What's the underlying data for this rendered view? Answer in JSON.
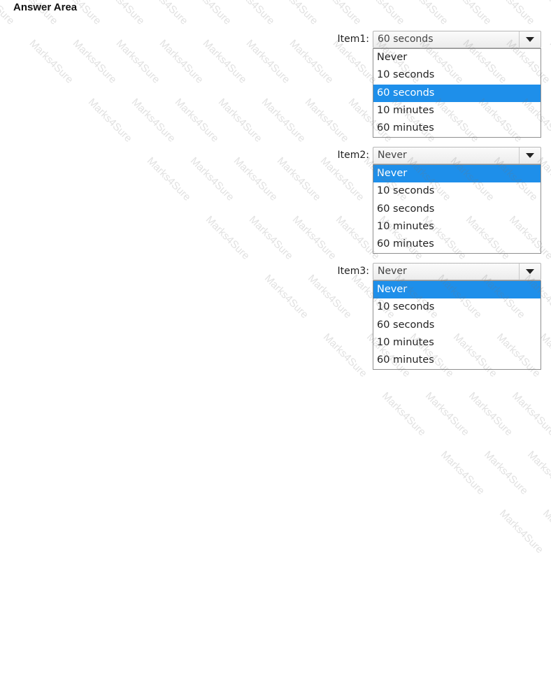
{
  "title": "Answer Area",
  "watermark": "Marks4Sure",
  "colors": {
    "highlight": "#1e8fea",
    "highlight_text": "#ffffff"
  },
  "items": [
    {
      "label": "Item1:",
      "selected_value": "60 seconds",
      "options": [
        "Never",
        "10 seconds",
        "60 seconds",
        "10 minutes",
        "60 minutes"
      ],
      "highlighted_index": 2
    },
    {
      "label": "Item2:",
      "selected_value": "Never",
      "options": [
        "Never",
        "10 seconds",
        "60 seconds",
        "10 minutes",
        "60 minutes"
      ],
      "highlighted_index": 0
    },
    {
      "label": "Item3:",
      "selected_value": "Never",
      "options": [
        "Never",
        "10 seconds",
        "60 seconds",
        "10 minutes",
        "60 minutes"
      ],
      "highlighted_index": 0
    }
  ]
}
